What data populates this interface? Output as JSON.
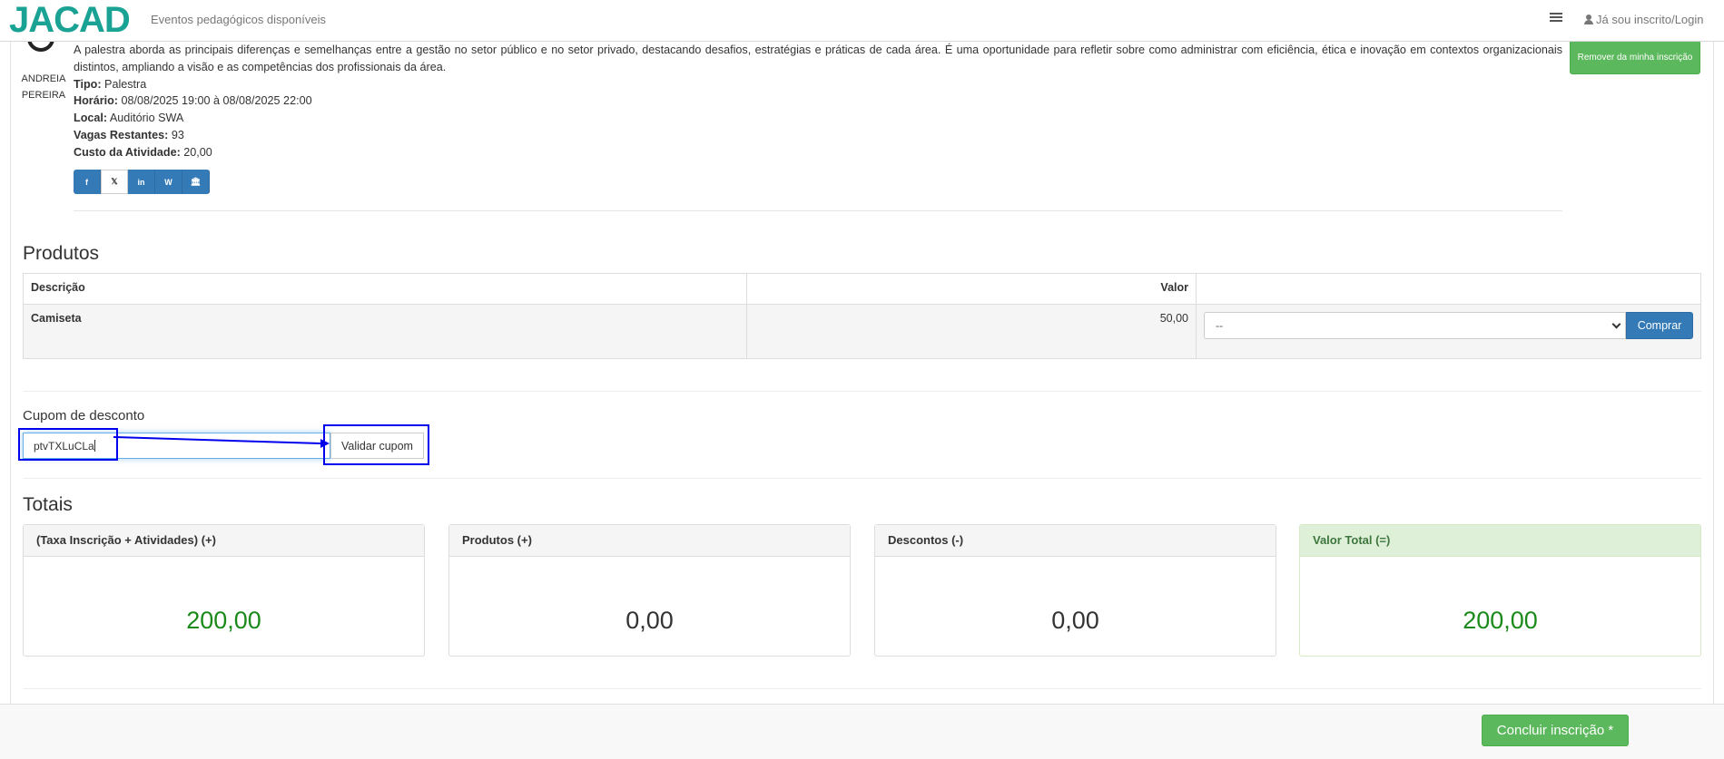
{
  "navbar": {
    "logo": "JACAD",
    "title": "Eventos pedagógicos disponíveis",
    "login": "Já sou inscrito/Login",
    "list_icon": "list-icon",
    "user_icon": "user-icon"
  },
  "activity": {
    "speaker_first": "ANDREIA",
    "speaker_last": "PEREIRA",
    "description": "A palestra aborda as principais diferenças e semelhanças entre a gestão no setor público e no setor privado, destacando desafios, estratégias e práticas de cada área. É uma oportunidade para refletir sobre como administrar com eficiência, ética e inovação em contextos organizacionais distintos, ampliando a visão e as competências dos profissionais da área.",
    "tipo_label": "Tipo:",
    "tipo": "Palestra",
    "horario_label": "Horário:",
    "horario": "08/08/2025 19:00 à 08/08/2025 22:00",
    "local_label": "Local:",
    "local": "Auditório SWA",
    "vagas_label": "Vagas Restantes:",
    "vagas": "93",
    "custo_label": "Custo da Atividade:",
    "custo": "20,00",
    "remove_button": "Remover da minha inscrição",
    "share_icons": [
      "facebook-icon",
      "x-icon",
      "linkedin-icon",
      "wordpress-icon",
      "institution-icon"
    ]
  },
  "products": {
    "title": "Produtos",
    "col_description": "Descrição",
    "col_value": "Valor",
    "rows": [
      {
        "description": "Camiseta",
        "value": "50,00",
        "select_value": "--",
        "buy_label": "Comprar"
      }
    ]
  },
  "coupon": {
    "label": "Cupom de desconto",
    "value": "ptvTXLuCLa",
    "validate_button": "Validar cupom"
  },
  "totals": {
    "title": "Totais",
    "panels": [
      {
        "label": "(Taxa Inscrição + Atividades) (+)",
        "value": "200,00"
      },
      {
        "label": "Produtos (+)",
        "value": "0,00"
      },
      {
        "label": "Descontos (-)",
        "value": "0,00"
      },
      {
        "label": "Valor Total (=)",
        "value": "200,00"
      }
    ]
  },
  "footer": {
    "conclude_button": "Concluir inscrição *"
  },
  "colors": {
    "brand": "#1aa394",
    "primary": "#337ab7",
    "success": "#5cb85c",
    "annotation": "#0000ee"
  }
}
